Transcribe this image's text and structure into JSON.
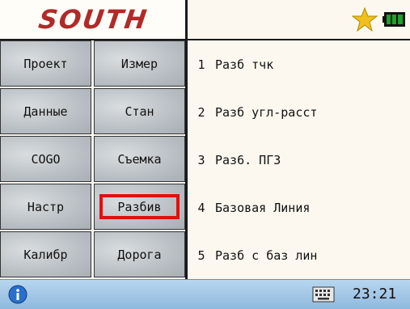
{
  "header": {
    "logo": "SOUTH"
  },
  "grid": [
    {
      "label": "Проект"
    },
    {
      "label": "Измер"
    },
    {
      "label": "Данные"
    },
    {
      "label": "Стан"
    },
    {
      "label": "COGO"
    },
    {
      "label": "Съемка"
    },
    {
      "label": "Настр"
    },
    {
      "label": "Разбив",
      "selected": true
    },
    {
      "label": "Калибр"
    },
    {
      "label": "Дорога"
    }
  ],
  "menu": [
    {
      "num": "1",
      "label": "Разб тчк"
    },
    {
      "num": "2",
      "label": "Разб угл-расст"
    },
    {
      "num": "3",
      "label": "Раз6. ПГЗ"
    },
    {
      "num": "4",
      "label": "Базовая Линия"
    },
    {
      "num": "5",
      "label": "Разб с баз лин"
    }
  ],
  "taskbar": {
    "time": "23:21"
  },
  "colors": {
    "selection": "#e01010",
    "logo": "#b02a2a",
    "star": "#f0c020",
    "battery": "#1fa02a"
  },
  "icons": [
    "star-icon",
    "battery-icon",
    "info-icon",
    "keyboard-icon"
  ]
}
